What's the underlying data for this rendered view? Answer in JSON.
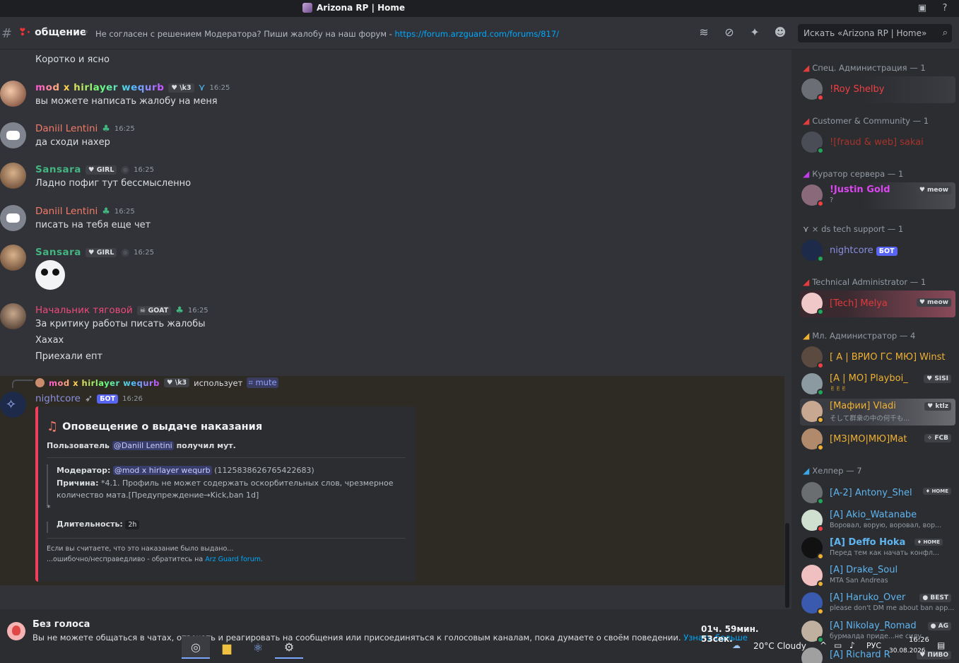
{
  "window": {
    "title": "Arizona RP | Home"
  },
  "header": {
    "channel": "общение",
    "topic_text": "Не согласен с решением Модератора? Пиши жалобу на наш форум - ",
    "topic_link": "https://forum.arzguard.com/forums/817/",
    "search_placeholder": "Искать «Arizona RP | Home»"
  },
  "messages": [
    {
      "text": "Коротко и ясно"
    },
    {
      "author": "mod x hirlayer wequrb",
      "tag": "\\k3",
      "time": "16:25",
      "text": "вы можете написать жалобу на меня"
    },
    {
      "author": "Daniil Lentini",
      "time": "16:25",
      "text": "да сходи нахер"
    },
    {
      "author": "Sansara",
      "tag": "GIRL",
      "time": "16:25",
      "text": "Ладно пофиг тут бессмысленно"
    },
    {
      "author": "Daniil Lentini",
      "time": "16:25",
      "text": "писать на тебя еще чет"
    },
    {
      "author": "Sansara",
      "tag": "GIRL",
      "time": "16:25",
      "text": ""
    },
    {
      "author": "Начальник тяговой",
      "tag": "GOAT",
      "time": "16:25",
      "lines": [
        "За критику работы писать жалобы",
        "Хахах",
        "Приехали епт"
      ]
    }
  ],
  "bot_message": {
    "reply_author": "mod x hirlayer wequrb",
    "reply_tag": "\\k3",
    "reply_uses": "использует",
    "reply_command": "mute",
    "author": "nightcore",
    "bot_label": "БОТ",
    "time": "16:26",
    "embed": {
      "title": "Оповещение о выдаче наказания",
      "user_prefix": "Пользователь",
      "user_mention": "@Daniil Lentini",
      "user_suffix": "получил мут.",
      "moderator_label": "Модератор:",
      "moderator_mention": "@mod x hirlayer wequrb",
      "moderator_id": "(1125838626765422683)",
      "reason_label": "Причина:",
      "reason_line1": "*4.1. Профиль не может содержать оскорбительных слов, чрезмерное",
      "reason_line2": "количество мата.[Предупреждение→Kick,ban 1d]",
      "reason_line3": "*",
      "duration_label": "Длительность:",
      "duration_value": "2h",
      "footer_line1": "Если вы считаете, что это наказание было выдано...",
      "footer_line2": "...ошибочно/несправедливо - обратитесь на ",
      "footer_link": "Arz Guard forum."
    }
  },
  "mute_bar": {
    "title": "Без голоса",
    "desc": "Вы не можете общаться в чатах, отвечать и реагировать на сообщения или присоединяться к голосовым каналам, пока думаете о своём поведении. ",
    "link": "Узнать больше",
    "timer": "01ч. 59мин. 53сек."
  },
  "members": {
    "roles": [
      {
        "name": "Спец. Администрация — 1",
        "color": "#e63c3c"
      },
      {
        "name": "Customer & Community — 1",
        "color": "#e63c3c"
      },
      {
        "name": "Куратор сервера — 1",
        "color": "#c13ce6"
      },
      {
        "name": "× ds tech support — 1",
        "color": "#b5bac1"
      },
      {
        "name": "Technical Administrator — 1",
        "color": "#e63c3c"
      },
      {
        "name": "Мл. Администратор — 4",
        "color": "#f0b132"
      },
      {
        "name": "Хелпер — 7",
        "color": "#3ca7e6"
      }
    ],
    "list": [
      {
        "name": "!Roy Shelby",
        "color": "#f23f43",
        "status": "",
        "tag": "",
        "dot": "#f23f43"
      },
      {
        "name": "![fraud & web] sakai",
        "color": "#c0392b",
        "status": "",
        "tag": "",
        "dot": "#23a55a"
      },
      {
        "name": "!Justin Gold",
        "color": "#d946ef",
        "status": "?",
        "tag": "meow",
        "dot": "#f23f43"
      },
      {
        "name": "nightcore",
        "color": "#8a8fe0",
        "status": "",
        "tag": "БОТ",
        "dot": "#23a55a"
      },
      {
        "name": "[Tech] Melya",
        "color": "#e03a3a",
        "status": "",
        "tag": "meow",
        "dot": "#23a55a"
      },
      {
        "name": "[ A | ВРИО ГС МЮ] Winst",
        "color": "#f0b132",
        "status": "",
        "tag": "",
        "dot": "#f23f43"
      },
      {
        "name": "[A | МО] Playboi_",
        "color": "#f0b132",
        "status": "✌✌✌",
        "tag": "SISI",
        "dot": "#23a55a"
      },
      {
        "name": "[Мафии] Vladi",
        "color": "#f0b132",
        "status": "そして群衆の中の何千も...",
        "tag": "ktlz",
        "dot": "#f0b132"
      },
      {
        "name": "[МЗ|МО|МЮ]Mat",
        "color": "#f0b132",
        "status": "",
        "tag": "FCB",
        "dot": "#f0b132"
      },
      {
        "name": "[A-2] Antony_Shel",
        "color": "#5fb5f0",
        "status": "",
        "tag": "HOME",
        "dot": "#23a55a"
      },
      {
        "name": "[A] Akio_Watanabe",
        "color": "#5fb5f0",
        "status": "Воровал, ворую, воровал, вор...",
        "tag": "",
        "dot": "#f23f43"
      },
      {
        "name": "[A] Deffo Hoka",
        "color": "#5fb5f0",
        "status": "Перед тем как начать конфл...",
        "tag": "HOME",
        "dot": "#f0b132"
      },
      {
        "name": "[A] Drake_Soul",
        "color": "#5fb5f0",
        "status": "MTA San Andreas",
        "tag": "",
        "dot": "#f0b132"
      },
      {
        "name": "[A] Haruko_Over",
        "color": "#5fb5f0",
        "status": "please don't DM me about ban app...",
        "tag": "BEST",
        "dot": "#f0b132"
      },
      {
        "name": "[A] Nikolay_Romad",
        "color": "#5fb5f0",
        "status": "бурмалда приде...не силу",
        "tag": "AG",
        "dot": "#23a55a"
      },
      {
        "name": "[A] Richard R",
        "color": "#5fb5f0",
        "status": "",
        "tag": "ПИВО",
        "dot": "#23a55a"
      }
    ]
  },
  "tray": {
    "weather": "20°C  Cloudy",
    "lang": "РУС",
    "time": "16:26",
    "date": "30.08.2026"
  }
}
